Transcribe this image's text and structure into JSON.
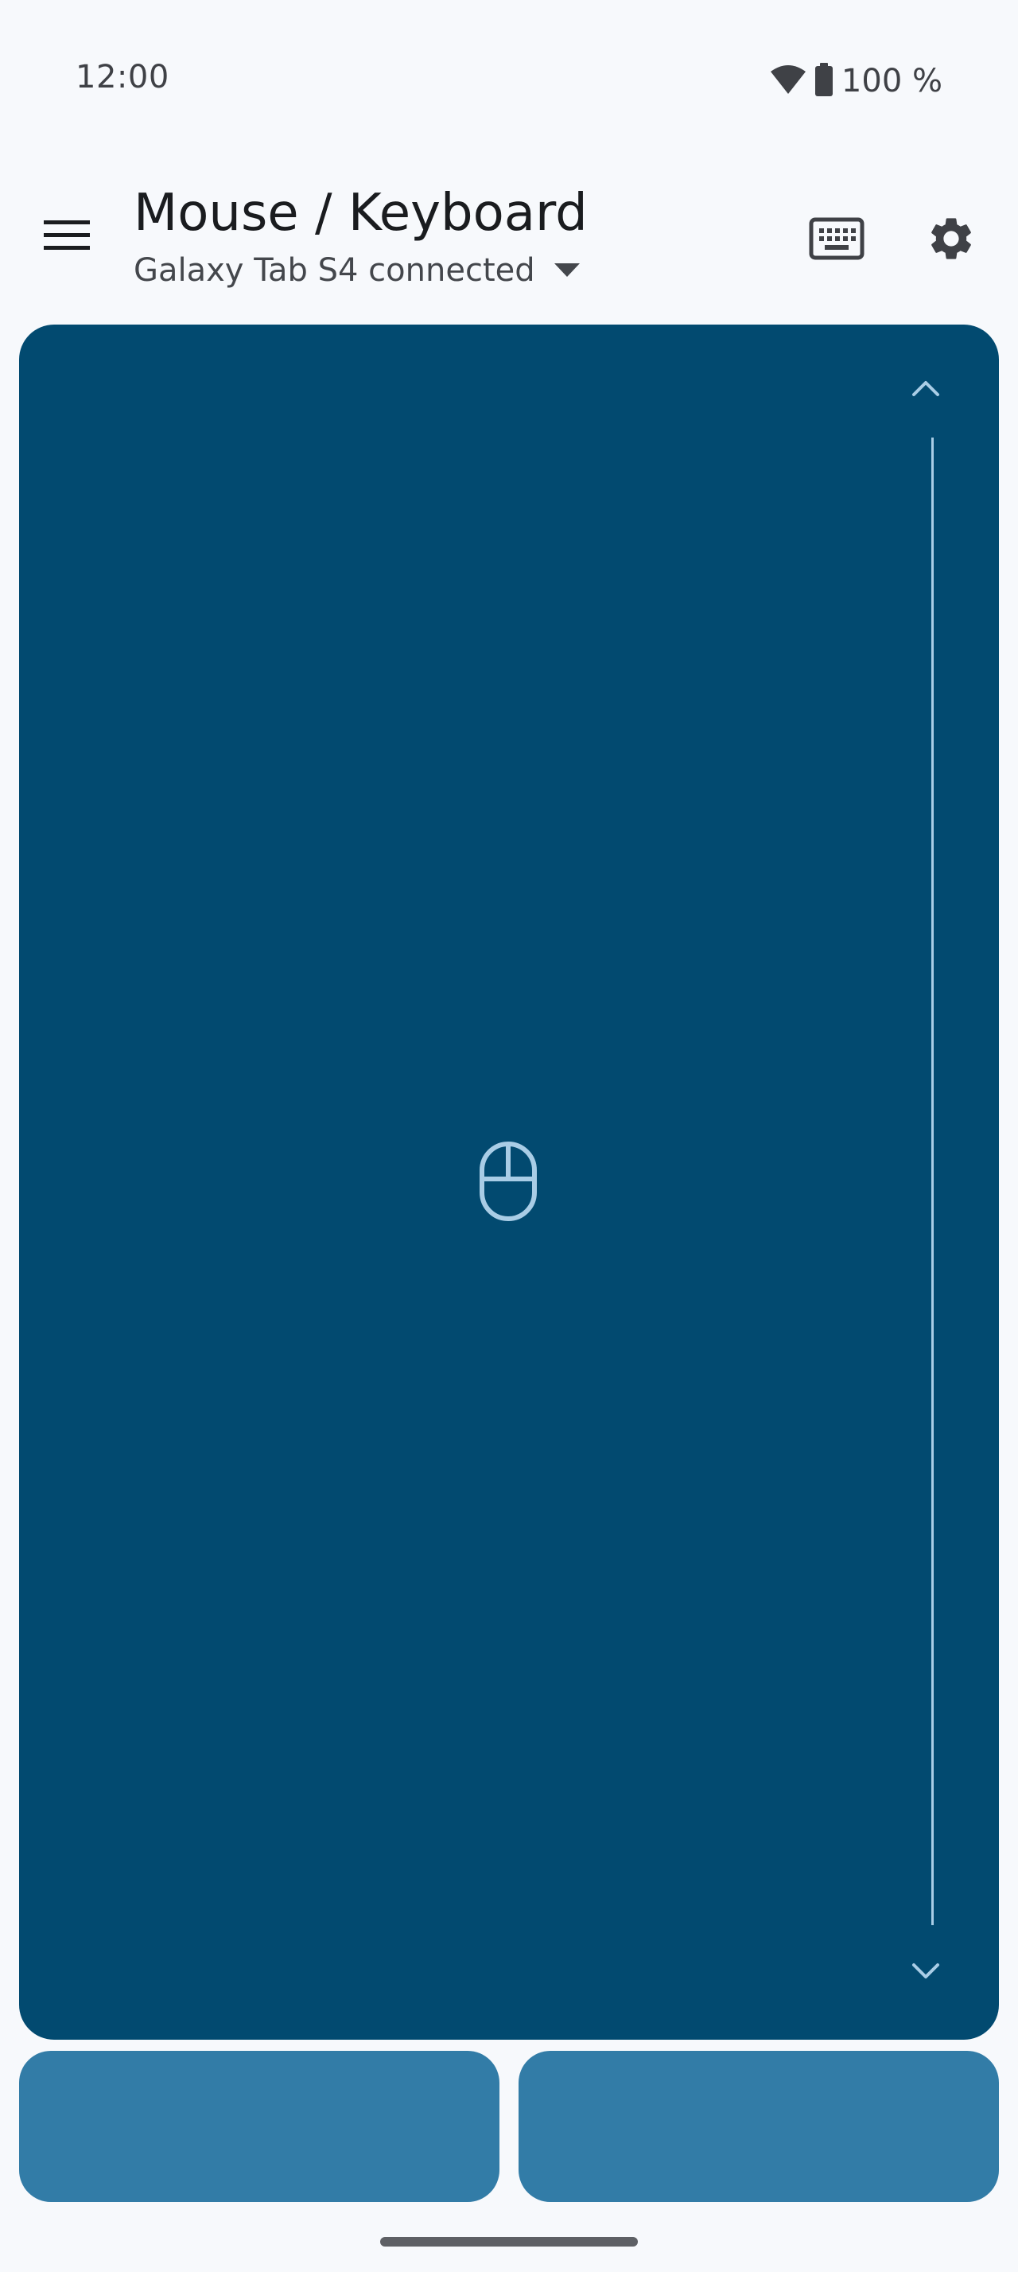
{
  "status_bar": {
    "time": "12:00",
    "battery": "100 %",
    "icons": [
      "wifi-icon",
      "battery-icon"
    ]
  },
  "app_bar": {
    "title": "Mouse / Keyboard",
    "device": "Galaxy Tab S4 connected",
    "icons": [
      "menu-icon",
      "dropdown-arrow-icon",
      "keyboard-icon",
      "settings-icon"
    ]
  },
  "touchpad": {
    "icons": [
      "chevron-up-icon",
      "mouse-icon",
      "chevron-down-icon"
    ]
  },
  "colors": {
    "background": "#f7f9fc",
    "touchpad": "#024a70",
    "mouse_button": "#327ca7",
    "touchpad_icon": "#a9cde6",
    "text_primary": "#1a1c1f",
    "text_secondary": "#44474c"
  }
}
